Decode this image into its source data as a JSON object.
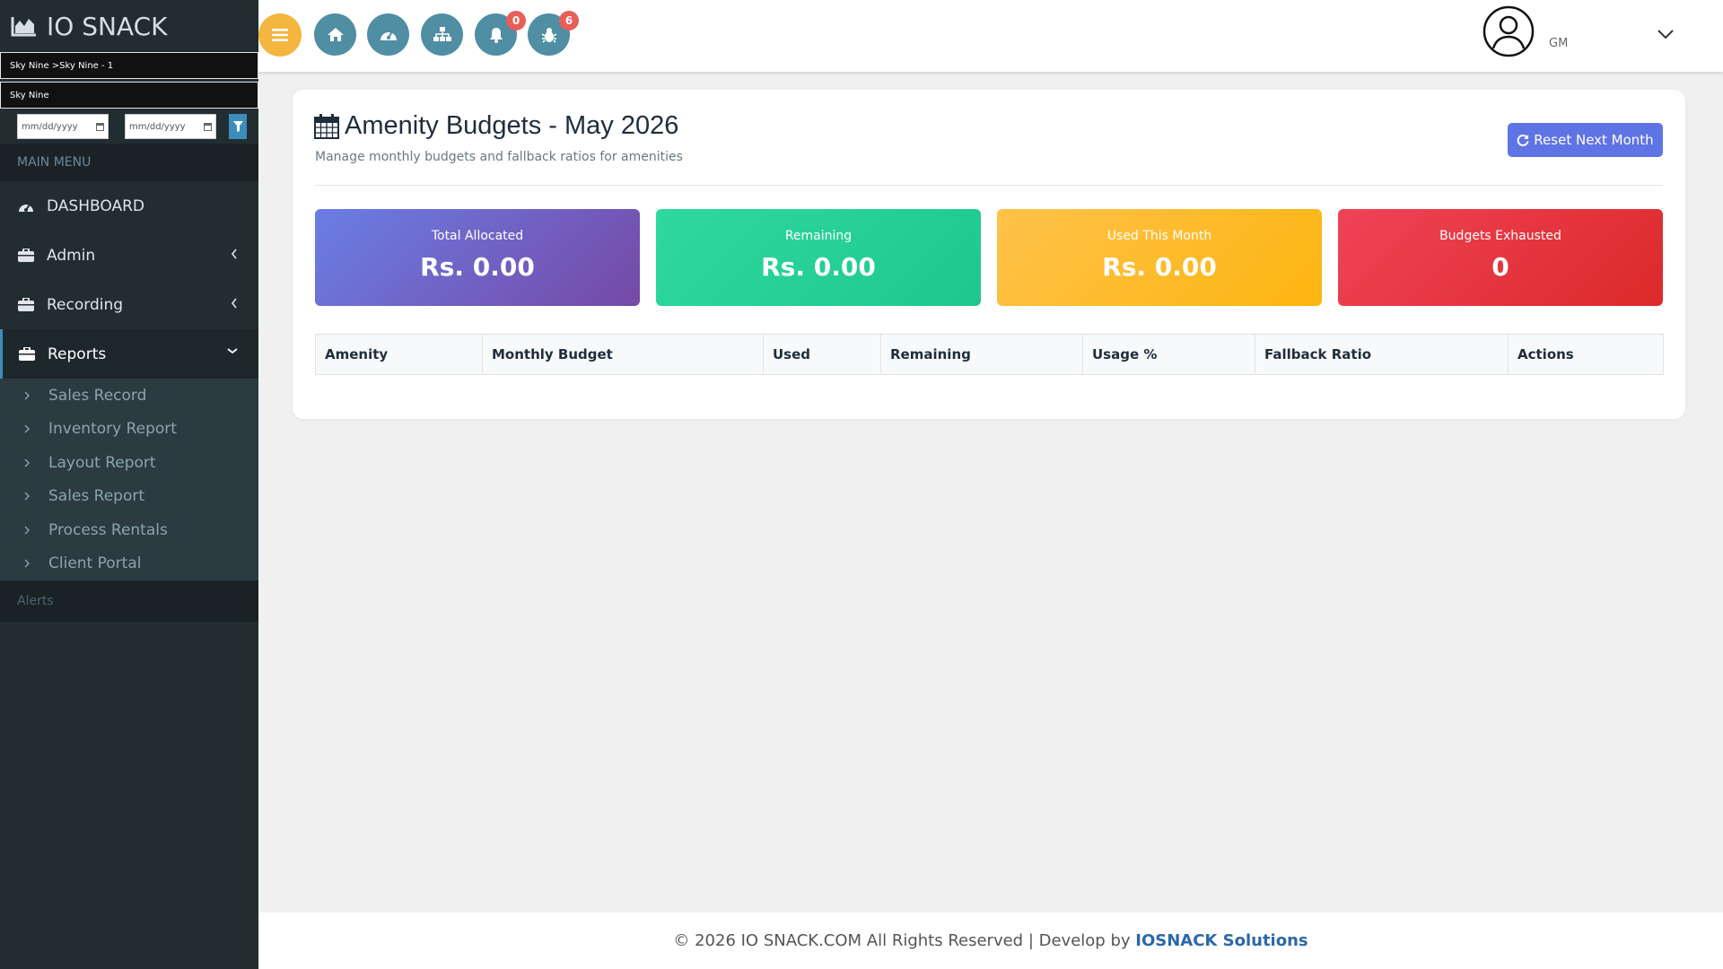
{
  "brand": {
    "name": "IO SNACK"
  },
  "location": {
    "path": "Sky Nine >Sky Nine - 1",
    "name": "Sky Nine"
  },
  "filters": {
    "date_from_placeholder": "mm/dd/yyyy",
    "date_to_placeholder": "mm/dd/yyyy"
  },
  "sidebar": {
    "header": "MAIN MENU",
    "items": [
      {
        "label": "DASHBOARD",
        "icon": "dashboard-icon"
      },
      {
        "label": "Admin",
        "icon": "briefcase-icon"
      },
      {
        "label": "Recording",
        "icon": "briefcase-icon"
      },
      {
        "label": "Reports",
        "icon": "briefcase-icon"
      }
    ],
    "submenu": [
      "Sales Record",
      "Inventory Report",
      "Layout Report",
      "Sales Report",
      "Process Rentals",
      "Client Portal"
    ],
    "alerts": "Alerts"
  },
  "topbar": {
    "notifications_count": "0",
    "bugs_count": "6",
    "user_initials": "GM"
  },
  "page": {
    "title": "Amenity Budgets - May 2026",
    "subtitle": "Manage monthly budgets and fallback ratios for amenities",
    "reset_button": "Reset Next Month"
  },
  "stats": [
    {
      "label": "Total Allocated",
      "value": "Rs. 0.00"
    },
    {
      "label": "Remaining",
      "value": "Rs. 0.00"
    },
    {
      "label": "Used This Month",
      "value": "Rs. 0.00"
    },
    {
      "label": "Budgets Exhausted",
      "value": "0"
    }
  ],
  "table": {
    "headers": [
      "Amenity",
      "Monthly Budget",
      "Used",
      "Remaining",
      "Usage %",
      "Fallback Ratio",
      "Actions"
    ]
  },
  "footer": {
    "copyright": "© 2026 IO SNACK.COM All Rights Reserved | Develop by ",
    "developer": "IOSNACK Solutions"
  },
  "colors": {
    "sidebar_bg": "#222d32",
    "accent_blue": "#3c8dbc",
    "menu_button": "#f4b63f",
    "top_icon": "#4f8ea3",
    "reset_button": "#5f74e4"
  }
}
